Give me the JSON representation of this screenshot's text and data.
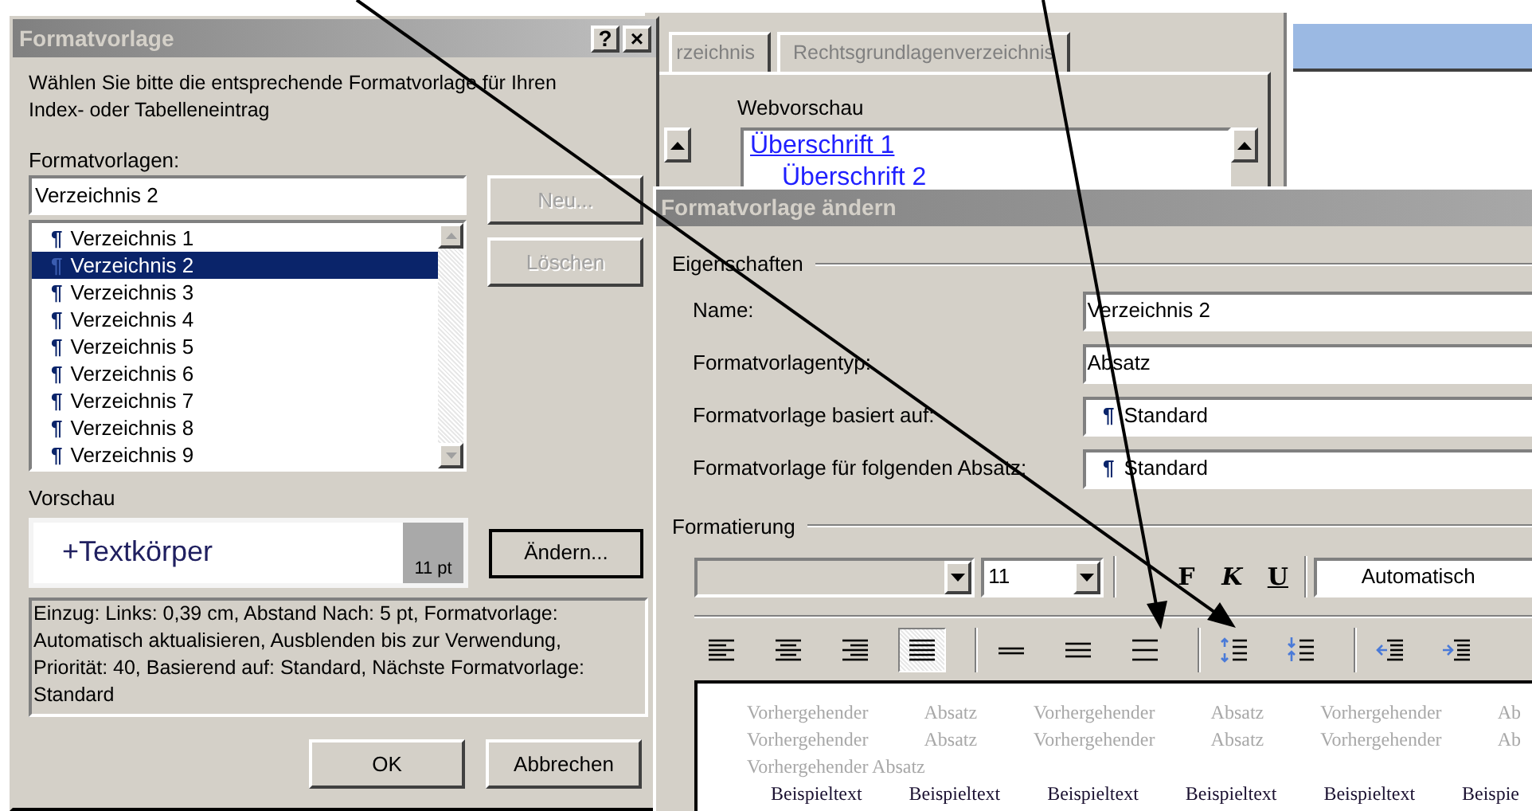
{
  "background_dialog": {
    "tabs": [
      "rzeichnis",
      "Rechtsgrundlagenverzeichnis"
    ],
    "web_preview": {
      "label": "Webvorschau",
      "entries": [
        "Überschrift 1",
        "Überschrift 2"
      ]
    }
  },
  "left_dialog": {
    "title": "Formatvorlage",
    "title_buttons": [
      "?",
      "×"
    ],
    "instruction": "Wählen Sie bitte die entsprechende Formatvorlage für Ihren Index- oder Tabelleneintrag",
    "styles_label": "Formatvorlagen:",
    "style_field": {
      "value": "Verzeichnis 2"
    },
    "style_list": [
      {
        "mark": "¶",
        "label": "Verzeichnis 1",
        "selected": false
      },
      {
        "mark": "¶",
        "label": "Verzeichnis 2",
        "selected": true
      },
      {
        "mark": "¶",
        "label": "Verzeichnis 3",
        "selected": false
      },
      {
        "mark": "¶",
        "label": "Verzeichnis 4",
        "selected": false
      },
      {
        "mark": "¶",
        "label": "Verzeichnis 5",
        "selected": false
      },
      {
        "mark": "¶",
        "label": "Verzeichnis 6",
        "selected": false
      },
      {
        "mark": "¶",
        "label": "Verzeichnis 7",
        "selected": false
      },
      {
        "mark": "¶",
        "label": "Verzeichnis 8",
        "selected": false
      },
      {
        "mark": "¶",
        "label": "Verzeichnis 9",
        "selected": false
      }
    ],
    "side_buttons": [
      {
        "label": "Neu...",
        "disabled": true
      },
      {
        "label": "Löschen",
        "disabled": true
      }
    ],
    "preview_label": "Vorschau",
    "preview": {
      "text": "+Textkörper",
      "size": "11 pt"
    },
    "modify_button": "Ändern...",
    "description": "Einzug: Links:  0,39 cm, Abstand Nach:  5 pt, Formatvorlage: Automatisch aktualisieren, Ausblenden bis zur Verwendung, Priorität: 40, Basierend auf: Standard, Nächste Formatvorlage: Standard",
    "buttons": [
      "OK",
      "Abbrechen"
    ]
  },
  "modify_dialog": {
    "title": "Formatvorlage ändern",
    "properties_label": "Eigenschaften",
    "properties": [
      {
        "label": "Name:",
        "kind": "text",
        "value": "Verzeichnis 2"
      },
      {
        "label": "Formatvorlagentyp:",
        "kind": "text",
        "value": "Absatz"
      },
      {
        "label": "Formatvorlage basiert auf:",
        "kind": "style",
        "mark": "¶",
        "value": "Standard"
      },
      {
        "label": "Formatvorlage für folgenden Absatz:",
        "kind": "style",
        "mark": "¶",
        "value": "Standard"
      }
    ],
    "formatting_label": "Formatierung",
    "font_size": "11",
    "style_buttons": [
      "F",
      "K",
      "U"
    ],
    "font_color": "Automatisch",
    "paragraph_tools": [
      {
        "kind": "align-left",
        "selected": false
      },
      {
        "kind": "align-center",
        "selected": false
      },
      {
        "kind": "align-right",
        "selected": false
      },
      {
        "kind": "justify",
        "selected": true
      },
      {
        "kind": "separator"
      },
      {
        "kind": "single-spacing",
        "selected": false
      },
      {
        "kind": "one-half-spacing",
        "selected": false
      },
      {
        "kind": "double-spacing",
        "selected": false
      },
      {
        "kind": "separator"
      },
      {
        "kind": "increase-spacing",
        "selected": false
      },
      {
        "kind": "decrease-spacing",
        "selected": false
      },
      {
        "kind": "separator"
      },
      {
        "kind": "decrease-indent",
        "selected": false
      },
      {
        "kind": "increase-indent",
        "selected": false
      }
    ],
    "preview": {
      "previous_lines": [
        "Vorhergehender Absatz Vorhergehender Absatz Vorhergehender Ab",
        "Vorhergehender Absatz Vorhergehender Absatz Vorhergehender Ab"
      ],
      "previous_last_line": "Vorhergehender Absatz",
      "sample_line": "Beispieltext Beispieltext Beispieltext Beispieltext Beispieltext Beispie"
    }
  }
}
